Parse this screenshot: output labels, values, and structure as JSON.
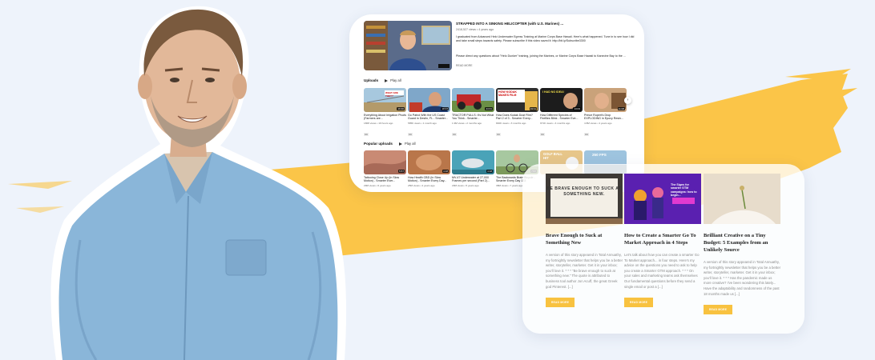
{
  "youtube": {
    "featured": {
      "title": "STRAPPED INTO A SINKING HELICOPTER (with U.S. Marines) ...",
      "meta": "2418,527 views • 4 years ago",
      "description": "I graduated from Advanced Helo Underwater Egress Training at Marine Corps Base Hawaii. Here's what happened. Tune in to see how I did and take small steps towards safety. Please subscribe if this video saved it: http://bit.ly/Subscribe3300",
      "description2": "Please direct any questions about \"Helo Dunker\" training, joining the Marines, or Marine Corps Base Hawaii to Kaneohe Bay to the ...",
      "read_more": "READ MORE",
      "duration": "11:18"
    },
    "uploads": {
      "heading": "Uploads",
      "play_all": "Play all",
      "videos": [
        {
          "title": "Everything About Irrigation Pivots (Farmers are...",
          "meta": "1808 views • 19 hours ago",
          "duration": "16:30",
          "cc": "CC",
          "badge": "WHAT ARE THEY?"
        },
        {
          "title": "Go Patrol With the US Coast Guard in Destin, FL - Smarter...",
          "meta": "585K views • 1 month ago",
          "duration": "18:17",
          "cc": "CC",
          "badge": ""
        },
        {
          "title": "TRACTOR PULLS: It's Not What You Think - Smarter...",
          "meta": "1.9M views • 2 months ago",
          "duration": "24:31",
          "cc": "CC",
          "badge": ""
        },
        {
          "title": "How Does Kodak Dust Film? Part 2 of 3 - Smarter Every...",
          "meta": "840K views • 3 months ago",
          "duration": "19:11",
          "cc": "CC",
          "badge": "HOW KODAK MAKES FILM"
        },
        {
          "title": "How Different Species of Fireflies Blink - Smarter Eve...",
          "meta": "971K views • 4 months ago",
          "duration": "13:03",
          "cc": "CC",
          "badge": "I HAD NO IDEA!"
        },
        {
          "title": "Prince Rupert's Drop EXPLODING in Epoxy Resin...",
          "meta": "4.8M views • 4 years ago",
          "duration": "11:08",
          "cc": "CC",
          "badge": ""
        }
      ]
    },
    "popular": {
      "heading": "Popular uploads",
      "play_all": "Play all",
      "videos": [
        {
          "title": "Tattooing Close Up (in Slow Motion) - Smarter Ever...",
          "meta": "29M views • 6 years ago",
          "duration": "5:57",
          "badge": ""
        },
        {
          "title": "How Health CBD (In Slow Motion) - Smarter Every Day...",
          "meta": "25M views • 4 years ago",
          "duration": "4:18",
          "badge": ""
        },
        {
          "title": "MV-47 Underwater at 27,000 Frames per second (Part 2)...",
          "meta": "29M views • 5 years ago",
          "duration": "4:18",
          "badge": ""
        },
        {
          "title": "The Backwards Brain Bicycle - Smarter Every Day 133",
          "meta": "38M views • 7 years ago",
          "duration": "7:57",
          "badge": ""
        },
        {
          "title": "Golf Ball Hit...",
          "meta": "",
          "duration": "",
          "badge": "GOLF BALL HIT"
        },
        {
          "title": "...",
          "meta": "",
          "duration": "",
          "badge": "250 FPS"
        }
      ]
    }
  },
  "blog": {
    "posts": [
      {
        "title": "Brave Enough to Suck at Something New",
        "excerpt": "A version of this story appeared in Total Annuathy, my fortnightly newsletter that helps you be a better writer, storyteller, marketer. Get it in your inbox; you'll love it. * * * \"Be brave enough to suck at something new.\" The quote is attributed to business tool author Jon Acuff, the great Greek god Pinterest. [...]",
        "button": "READ MORE",
        "board_text": "BE BRAVE ENOUGH TO SUCK AT SOMETHING NEW."
      },
      {
        "title": "How to Create a Smarter Go To Market Approach in 4 Steps",
        "excerpt": "Let's talk about how you can create a smarter Go To Market approach... in four steps. Here's my advice on the questions you need to ask to help you create a Smarter GTM approach. * * * On your sales and marketing teams ask themselves Our fundamental questions before they send a single email or post a [...]",
        "button": "READ MORE",
        "promo_text": "The Signs for smarter GTM campaigns: how to begin..."
      },
      {
        "title": "Brilliant Creative on a Tiny Budget: 5 Examples from an Unlikely Source",
        "excerpt": "A version of this story appeared in Total Annuathy, my fortnightly newsletter that helps you be a better writer, storyteller, marketer. Get it in your inbox; you'll love it. * * * Has the pandemic made us more creative? I've been wondering this lately... Have the adaptability and randomness of the past 18 months made us [...]",
        "button": "READ MORE"
      }
    ]
  },
  "colors": {
    "background": "#eef3fb",
    "brush_yellow": "#fbc548",
    "blog_button": "#f8c240",
    "shirt_blue": "#8ab6d9"
  }
}
